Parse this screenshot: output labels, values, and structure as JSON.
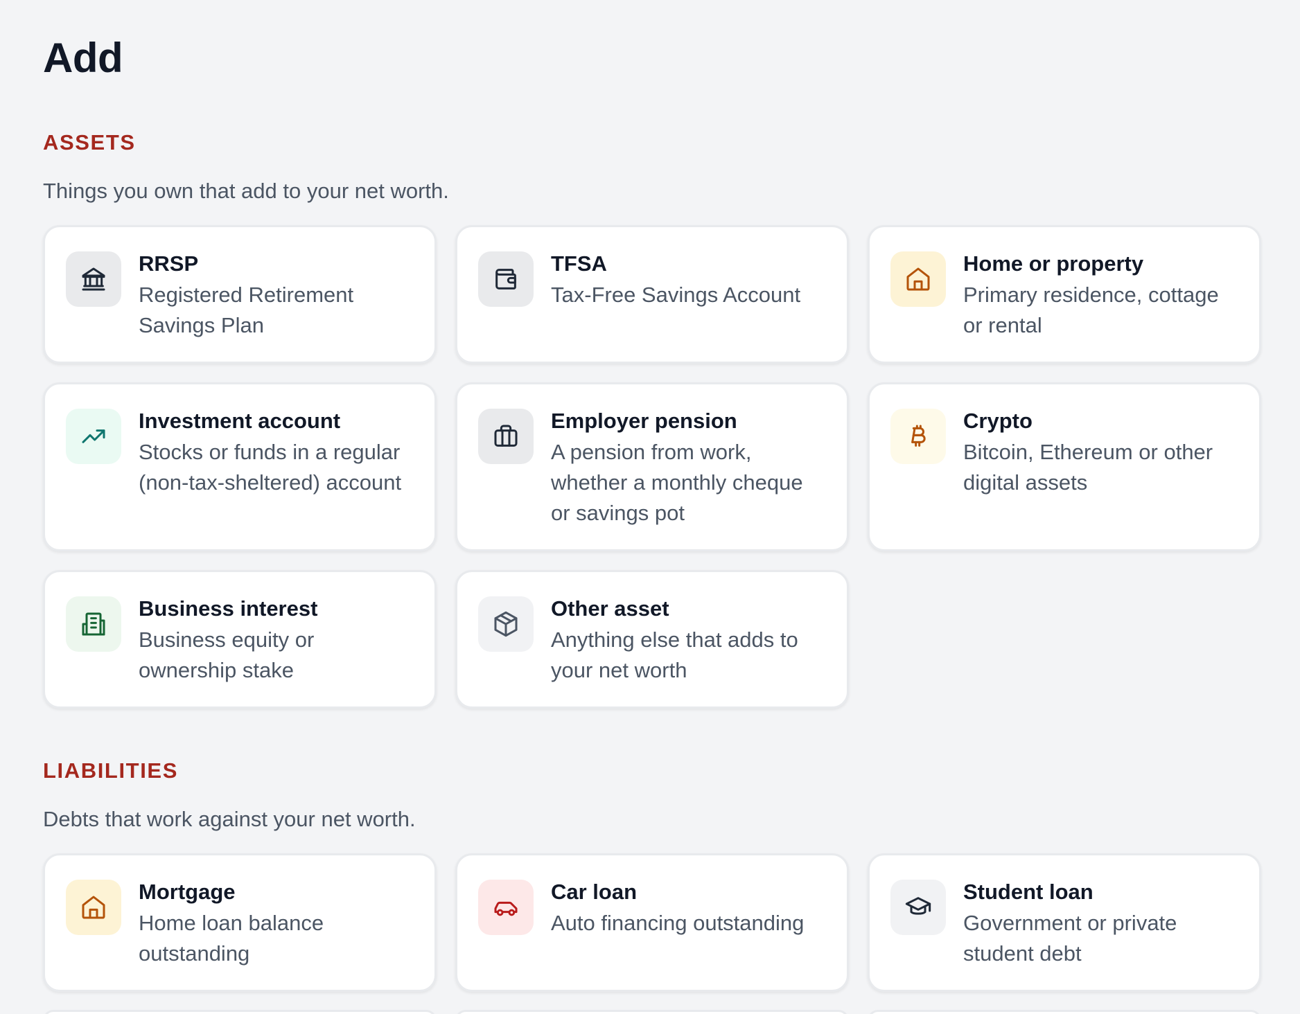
{
  "page": {
    "title": "Add"
  },
  "colors": {
    "section_title": "#a4281e",
    "neutral_bg": "#e9eaec",
    "home_bg": "#fdf3d5",
    "home_fg": "#b45309",
    "invest_bg": "#eafaf3",
    "invest_fg": "#0f766e",
    "crypto_bg": "#fefae9",
    "crypto_fg": "#b45309",
    "business_bg": "#edf7ee",
    "business_fg": "#166534",
    "car_bg": "#fde8e8",
    "car_fg": "#b91c1c",
    "student_bg": "#f1f2f4"
  },
  "assets": {
    "title": "ASSETS",
    "description": "Things you own that add to your net worth.",
    "items": [
      {
        "title": "RRSP",
        "description": "Registered Retirement Savings Plan",
        "icon": "bank-icon"
      },
      {
        "title": "TFSA",
        "description": "Tax-Free Savings Account",
        "icon": "wallet-icon"
      },
      {
        "title": "Home or property",
        "description": "Primary residence, cottage or rental",
        "icon": "home-icon"
      },
      {
        "title": "Investment account",
        "description": "Stocks or funds in a regular (non-tax-sheltered) account",
        "icon": "trending-up-icon"
      },
      {
        "title": "Employer pension",
        "description": "A pension from work, whether a monthly cheque or savings pot",
        "icon": "briefcase-icon"
      },
      {
        "title": "Crypto",
        "description": "Bitcoin, Ethereum or other digital assets",
        "icon": "bitcoin-icon"
      },
      {
        "title": "Business interest",
        "description": "Business equity or ownership stake",
        "icon": "building-icon"
      },
      {
        "title": "Other asset",
        "description": "Anything else that adds to your net worth",
        "icon": "box-icon"
      }
    ]
  },
  "liabilities": {
    "title": "LIABILITIES",
    "description": "Debts that work against your net worth.",
    "items": [
      {
        "title": "Mortgage",
        "description": "Home loan balance outstanding",
        "icon": "home-icon"
      },
      {
        "title": "Car loan",
        "description": "Auto financing outstanding",
        "icon": "car-icon"
      },
      {
        "title": "Student loan",
        "description": "Government or private student debt",
        "icon": "graduation-cap-icon"
      }
    ]
  }
}
